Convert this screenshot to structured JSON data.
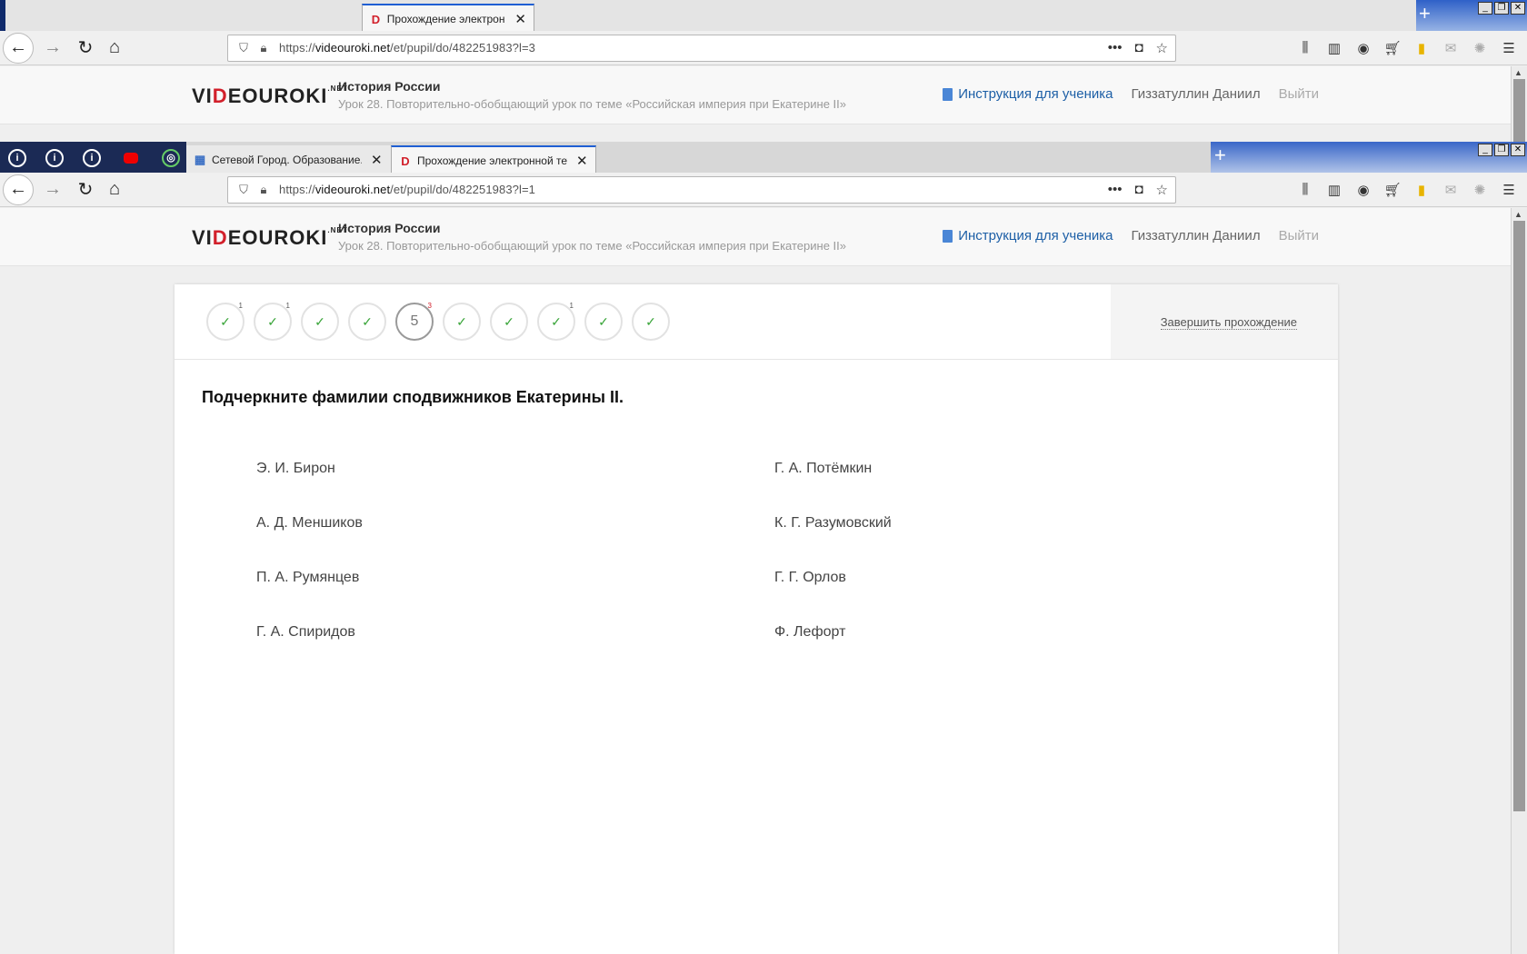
{
  "back_window": {
    "tab_title": "Прохождение электронно",
    "url_prefix": "https://",
    "url_host": "videouroki.net",
    "url_path": "/et/pupil/do/482251983?l=3"
  },
  "front_window": {
    "tabs": [
      {
        "title": "Сетевой Город. Образование. Д"
      },
      {
        "title": "Прохождение электронной тетр"
      }
    ],
    "url_prefix": "https://",
    "url_host": "videouroki.net",
    "url_path": "/et/pupil/do/482251983?l=1"
  },
  "site": {
    "logo_a": "VI",
    "logo_d": "D",
    "logo_b": "EOUROKI",
    "logo_net": ".NET",
    "course": "История России",
    "lesson": "Урок 28. Повторительно-обобщающий урок по теме «Российская империя при Екатерине II»",
    "instruction_link": "Инструкция для ученика",
    "user_name": "Гиззатуллин Даниил",
    "logout": "Выйти"
  },
  "quiz": {
    "steps": [
      {
        "label": "✓",
        "badge": "1",
        "state": "done"
      },
      {
        "label": "✓",
        "badge": "1",
        "state": "done"
      },
      {
        "label": "✓",
        "badge": "",
        "state": "done"
      },
      {
        "label": "✓",
        "badge": "",
        "state": "done"
      },
      {
        "label": "5",
        "badge": "3",
        "state": "current"
      },
      {
        "label": "✓",
        "badge": "",
        "state": "done"
      },
      {
        "label": "✓",
        "badge": "",
        "state": "done"
      },
      {
        "label": "✓",
        "badge": "1",
        "state": "done"
      },
      {
        "label": "✓",
        "badge": "",
        "state": "done"
      },
      {
        "label": "✓",
        "badge": "",
        "state": "done"
      }
    ],
    "finish_label": "Завершить прохождение",
    "question": "Подчеркните фамилии сподвижников Екатерины II.",
    "answers": [
      "Э. И. Бирон",
      "Г. А. Потёмкин",
      "А. Д. Меншиков",
      "К. Г. Разумовский",
      "П. А. Румянцев",
      "Г. Г. Орлов",
      "Г. А. Спиридов",
      "Ф. Лефорт"
    ]
  },
  "colors": {
    "brand_red": "#d2202b",
    "link_blue": "#1d5fa6",
    "check_green": "#3aa53a"
  }
}
